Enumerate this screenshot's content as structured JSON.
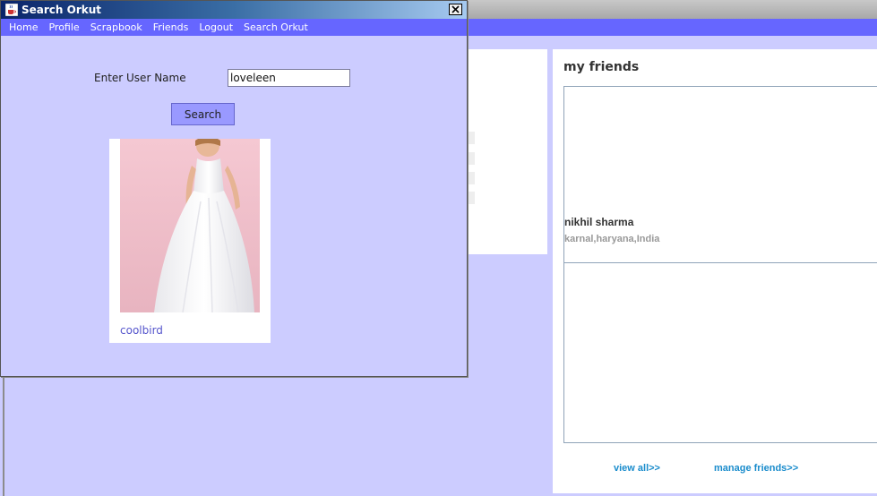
{
  "dialog": {
    "title": "Search Orkut",
    "menu": [
      "Home",
      "Profile",
      "Scrapbook",
      "Friends",
      "Logout",
      "Search Orkut"
    ],
    "form": {
      "label": "Enter User Name",
      "input_value": "loveleen",
      "button_label": "Search"
    },
    "result": {
      "username": "coolbird"
    }
  },
  "friends": {
    "title": "my friends",
    "items": [
      {
        "name": "nikhil sharma",
        "location": "karnal,haryana,India"
      }
    ],
    "links": {
      "view_all": "view all>>",
      "manage": "manage friends>>"
    }
  },
  "colors": {
    "menubar": "#6666ff",
    "window_bg": "#ccccff",
    "button": "#9999ff",
    "link": "#1a8ccc"
  }
}
